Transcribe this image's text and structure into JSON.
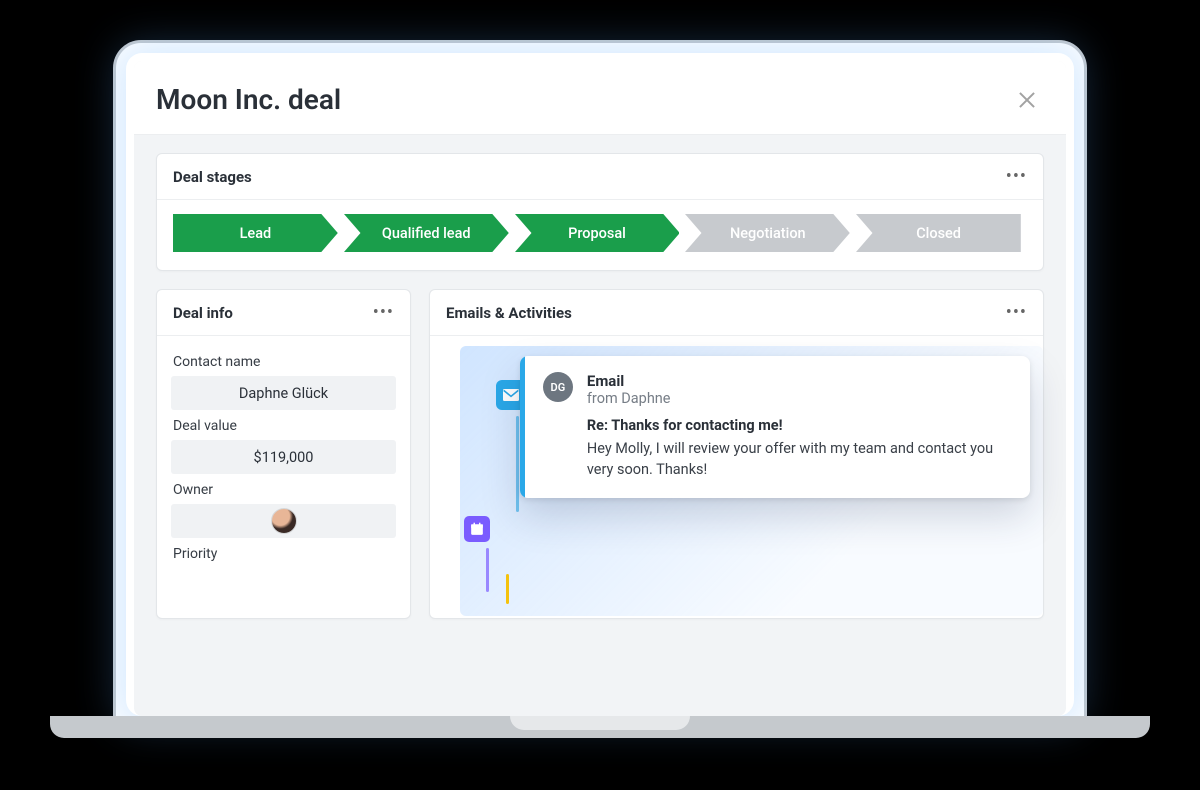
{
  "header": {
    "title": "Moon Inc. deal"
  },
  "stages": {
    "title": "Deal stages",
    "items": [
      {
        "label": "Lead",
        "active": true
      },
      {
        "label": "Qualified lead",
        "active": true
      },
      {
        "label": "Proposal",
        "active": true
      },
      {
        "label": "Negotiation",
        "active": false
      },
      {
        "label": "Closed",
        "active": false
      }
    ],
    "colors": {
      "active": "#1a9e4b",
      "inactive": "#c7cace"
    }
  },
  "deal_info": {
    "title": "Deal info",
    "contact_label": "Contact name",
    "contact_value": "Daphne Glück",
    "value_label": "Deal value",
    "value_value": "$119,000",
    "owner_label": "Owner",
    "priority_label": "Priority"
  },
  "activities": {
    "title": "Emails & Activities",
    "email": {
      "avatar_initials": "DG",
      "type_label": "Email",
      "from_label": "from Daphne",
      "subject": "Re: Thanks for contacting me!",
      "body": "Hey Molly, I will review your offer with my team and contact you very soon. Thanks!"
    }
  }
}
